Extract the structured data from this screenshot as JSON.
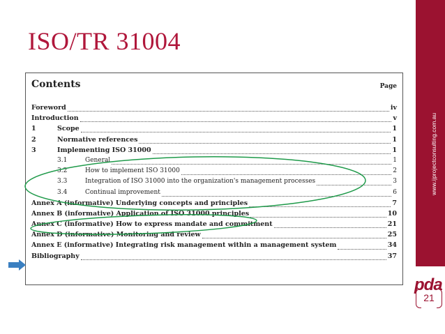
{
  "slide": {
    "title": "ISO/TR 31004",
    "website": "www.ijprojectconsulting.com.au",
    "logo": "pda",
    "page_number": "21",
    "brand_color": "#9b1230"
  },
  "document": {
    "heading": "Contents",
    "page_label": "Page",
    "entries": [
      {
        "num": "",
        "label": "Foreword",
        "page": "iv",
        "bold": true,
        "sub": false
      },
      {
        "num": "",
        "label": "Introduction",
        "page": "v",
        "bold": true,
        "sub": false
      },
      {
        "num": "1",
        "label": "Scope",
        "page": "1",
        "bold": true,
        "sub": false
      },
      {
        "num": "2",
        "label": "Normative references",
        "page": "1",
        "bold": true,
        "sub": false
      },
      {
        "num": "3",
        "label": "Implementing ISO 31000",
        "page": "1",
        "bold": true,
        "sub": false
      },
      {
        "num": "3.1",
        "label": "General",
        "page": "1",
        "bold": false,
        "sub": true
      },
      {
        "num": "3.2",
        "label": "How to implement ISO 31000",
        "page": "2",
        "bold": false,
        "sub": true
      },
      {
        "num": "3.3",
        "label": "Integration of ISO 31000 into the organization's management processes",
        "page": "3",
        "bold": false,
        "sub": true
      },
      {
        "num": "3.4",
        "label": "Continual improvement",
        "page": "6",
        "bold": false,
        "sub": true
      },
      {
        "num": "",
        "label": "Annex A (informative) Underlying concepts and principles",
        "page": "7",
        "bold": true,
        "sub": false
      },
      {
        "num": "",
        "label": "Annex B (informative) Application of ISO 31000 principles",
        "page": "10",
        "bold": true,
        "sub": false
      },
      {
        "num": "",
        "label": "Annex C (informative) How to express mandate and commitment",
        "page": "21",
        "bold": true,
        "sub": false
      },
      {
        "num": "",
        "label": "Annex D (informative) Monitoring and review",
        "page": "25",
        "bold": true,
        "sub": false
      },
      {
        "num": "",
        "label": "Annex E (informative) Integrating risk management within a management system",
        "page": "34",
        "bold": true,
        "sub": false
      },
      {
        "num": "",
        "label": "Bibliography",
        "page": "37",
        "bold": true,
        "sub": false
      }
    ]
  },
  "annotations": {
    "ellipse_color": "#1f9a4a",
    "arrow_color": "#3a7fc1"
  }
}
